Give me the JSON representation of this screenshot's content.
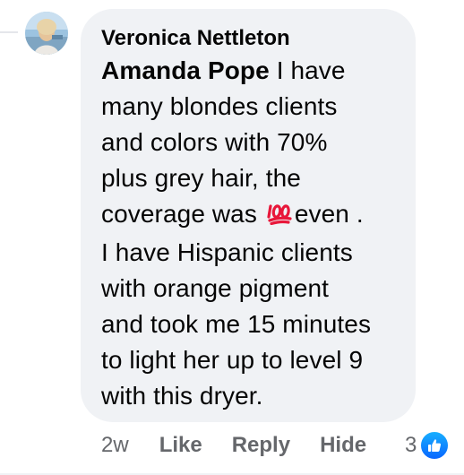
{
  "comment": {
    "author": "Veronica Nettleton",
    "mention": "Amanda Pope",
    "lines": [
      " I have",
      "many blondes clients",
      "and colors with 70%",
      "plus grey hair, the",
      "coverage was ",
      "even .",
      "I have Hispanic clients",
      "with orange pigment",
      "and took me 15 minutes",
      "to light her up to level 9",
      "with this dryer."
    ],
    "emoji": "hundred-points-emoji"
  },
  "actions": {
    "time": "2w",
    "like": "Like",
    "reply": "Reply",
    "hide": "Hide"
  },
  "reactions": {
    "count": "3",
    "icon": "like-icon",
    "badge_color": "#0866ff"
  },
  "colors": {
    "bubble": "#f0f2f5",
    "text": "#050505",
    "secondary_text": "#65676b"
  }
}
